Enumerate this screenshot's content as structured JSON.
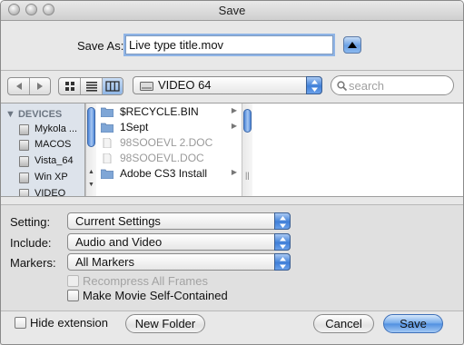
{
  "window": {
    "title": "Save"
  },
  "save_as": {
    "label": "Save As:",
    "value": "Live type title.mov"
  },
  "toolbar": {
    "location": "VIDEO 64",
    "search_placeholder": "search",
    "back_icon": "back-arrow-icon",
    "forward_icon": "forward-arrow-icon"
  },
  "sidebar": {
    "header": "DEVICES",
    "items": [
      {
        "label": "Mykola ..."
      },
      {
        "label": "MACOS"
      },
      {
        "label": "Vista_64"
      },
      {
        "label": "Win XP"
      },
      {
        "label": "VIDEO"
      }
    ]
  },
  "files": [
    {
      "name": "$RECYCLE.BIN",
      "kind": "folder",
      "enabled": true
    },
    {
      "name": "1Sept",
      "kind": "folder",
      "enabled": true
    },
    {
      "name": "98SOOEVL 2.DOC",
      "kind": "document",
      "enabled": false
    },
    {
      "name": "98SOOEVL.DOC",
      "kind": "document",
      "enabled": false
    },
    {
      "name": "Adobe CS3 Install",
      "kind": "folder",
      "enabled": true
    }
  ],
  "options": {
    "setting": {
      "label": "Setting:",
      "value": "Current Settings"
    },
    "include": {
      "label": "Include:",
      "value": "Audio and Video"
    },
    "markers": {
      "label": "Markers:",
      "value": "All Markers"
    },
    "recompress": {
      "label": "Recompress All Frames",
      "checked": false,
      "enabled": false
    },
    "self_contained": {
      "label": "Make Movie Self-Contained",
      "checked": false,
      "enabled": true
    }
  },
  "footer": {
    "hide_extension": "Hide extension",
    "new_folder": "New Folder",
    "cancel": "Cancel",
    "save": "Save"
  },
  "colors": {
    "accent": "#5a95e2",
    "selection": "#8fb4e6"
  }
}
